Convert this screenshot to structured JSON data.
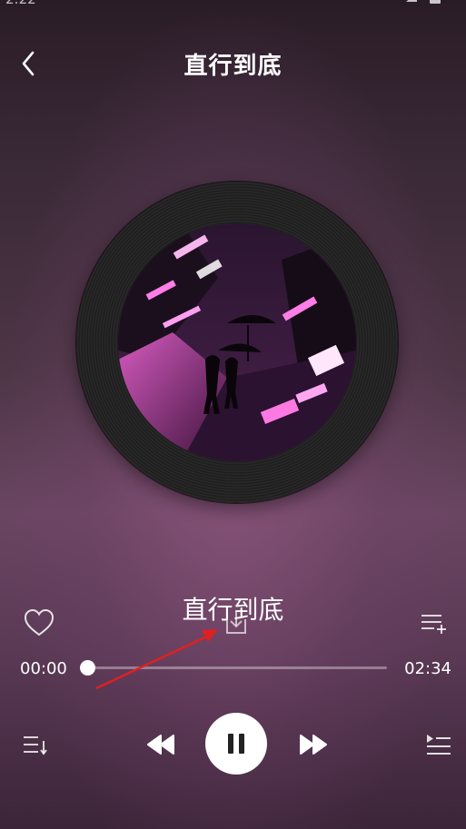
{
  "status_bar": {
    "time": "2:22"
  },
  "header": {
    "title": "直行到底"
  },
  "player": {
    "song_title": "直行到底",
    "current_time": "00:00",
    "total_time": "02:34",
    "progress_fraction": 0.0,
    "is_playing": true
  },
  "icons": {
    "back": "chevron-left-icon",
    "like": "heart-icon",
    "download": "download-icon",
    "add_to_playlist": "playlist-add-icon",
    "playlist": "list-sort-icon",
    "prev": "rewind-icon",
    "play_pause": "pause-icon",
    "next": "fast-forward-icon",
    "queue": "queue-icon"
  },
  "colors": {
    "annotation_arrow": "#e02020",
    "accent_pink": "#d94fc3"
  }
}
